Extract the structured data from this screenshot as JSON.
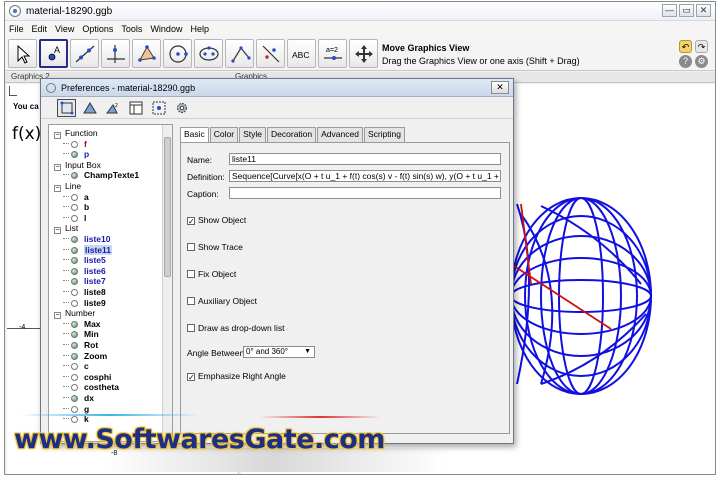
{
  "window": {
    "title": "material-18290.ggb",
    "min": "—",
    "max": "▭",
    "close": "✕"
  },
  "menu": [
    "File",
    "Edit",
    "View",
    "Options",
    "Tools",
    "Window",
    "Help"
  ],
  "toolbar": {
    "tools": [
      {
        "name": "move-tool",
        "glyph": "arrow"
      },
      {
        "name": "point-tool",
        "glyph": "A"
      },
      {
        "name": "line-tool",
        "glyph": "line"
      },
      {
        "name": "perpendicular-tool",
        "glyph": "perp"
      },
      {
        "name": "polygon-tool",
        "glyph": "poly"
      },
      {
        "name": "circle-tool",
        "glyph": "circle"
      },
      {
        "name": "conic-tool",
        "glyph": "conic"
      },
      {
        "name": "angle-tool",
        "glyph": "angle"
      },
      {
        "name": "reflect-tool",
        "glyph": "reflect"
      },
      {
        "name": "text-tool",
        "glyph": "ABC"
      },
      {
        "name": "slider-tool",
        "glyph": "a=2"
      },
      {
        "name": "move-view-tool",
        "glyph": "move"
      }
    ],
    "help_title": "Move Graphics View",
    "help_text": "Drag the Graphics View or one axis (Shift + Drag)"
  },
  "views": {
    "graphics2": "Graphics 2",
    "graphics1": "Graphics"
  },
  "left_panel": {
    "you_can": "You ca",
    "fx": "f(x)",
    "tick": "-4"
  },
  "bottom_axis": {
    "tick": "-8"
  },
  "dialog": {
    "title": "Preferences - material-18290.ggb",
    "close": "✕",
    "tree": [
      {
        "type": "cat",
        "label": "Function"
      },
      {
        "type": "item",
        "label": "f",
        "color": "#c00000",
        "dot": "empty"
      },
      {
        "type": "item",
        "label": "p",
        "color": "#1a1aa8",
        "dot": "filled"
      },
      {
        "type": "cat",
        "label": "Input Box"
      },
      {
        "type": "item",
        "label": "ChampTexte1",
        "color": "#000000",
        "dot": "filled"
      },
      {
        "type": "cat",
        "label": "Line"
      },
      {
        "type": "item",
        "label": "a",
        "color": "#000000",
        "dot": "empty"
      },
      {
        "type": "item",
        "label": "b",
        "color": "#000000",
        "dot": "empty"
      },
      {
        "type": "item",
        "label": "l",
        "color": "#000000",
        "dot": "empty"
      },
      {
        "type": "cat",
        "label": "List"
      },
      {
        "type": "item",
        "label": "liste10",
        "color": "#1a1aa8",
        "dot": "filled"
      },
      {
        "type": "item",
        "label": "liste11",
        "color": "#1a1aa8",
        "dot": "filled",
        "selected": true
      },
      {
        "type": "item",
        "label": "liste5",
        "color": "#1a1aa8",
        "dot": "filled"
      },
      {
        "type": "item",
        "label": "liste6",
        "color": "#1a1aa8",
        "dot": "filled"
      },
      {
        "type": "item",
        "label": "liste7",
        "color": "#1a1aa8",
        "dot": "filled"
      },
      {
        "type": "item",
        "label": "liste8",
        "color": "#000000",
        "dot": "empty"
      },
      {
        "type": "item",
        "label": "liste9",
        "color": "#000000",
        "dot": "empty"
      },
      {
        "type": "cat",
        "label": "Number"
      },
      {
        "type": "item",
        "label": "Max",
        "color": "#000000",
        "dot": "filled"
      },
      {
        "type": "item",
        "label": "Min",
        "color": "#000000",
        "dot": "filled"
      },
      {
        "type": "item",
        "label": "Rot",
        "color": "#000000",
        "dot": "filled"
      },
      {
        "type": "item",
        "label": "Zoom",
        "color": "#000000",
        "dot": "filled"
      },
      {
        "type": "item",
        "label": "c",
        "color": "#000000",
        "dot": "empty"
      },
      {
        "type": "item",
        "label": "cosphi",
        "color": "#000000",
        "dot": "empty"
      },
      {
        "type": "item",
        "label": "costheta",
        "color": "#000000",
        "dot": "empty"
      },
      {
        "type": "item",
        "label": "dx",
        "color": "#000000",
        "dot": "filled"
      },
      {
        "type": "item",
        "label": "g",
        "color": "#000000",
        "dot": "empty"
      },
      {
        "type": "item",
        "label": "k",
        "color": "#000000",
        "dot": "empty"
      }
    ],
    "tabs": [
      "Basic",
      "Color",
      "Style",
      "Decoration",
      "Advanced",
      "Scripting"
    ],
    "active_tab": "Basic",
    "name_label": "Name:",
    "name_value": "liste11",
    "definition_label": "Definition:",
    "definition_value": "Sequence[Curve[x(O + t u_1 + f(t) cos(s) v - f(t) sin(s) w), y(O + t u_1 + f(t) c",
    "caption_label": "Caption:",
    "caption_value": "",
    "checkboxes": [
      {
        "label": "Show Object",
        "checked": true
      },
      {
        "label": "Show Trace",
        "checked": false
      },
      {
        "label": "Fix Object",
        "checked": false
      },
      {
        "label": "Auxiliary Object",
        "checked": false
      },
      {
        "label": "Draw as drop-down list",
        "checked": false
      }
    ],
    "angle_label": "Angle Between:",
    "angle_value": "0° and 360°",
    "emphasize_label": "Emphasize Right Angle",
    "emphasize_checked": true
  },
  "watermark": "www.SoftwaresGate.com",
  "colors": {
    "accent": "#1b2f86",
    "wire": "#1010e0",
    "axis_red": "#d01010"
  }
}
